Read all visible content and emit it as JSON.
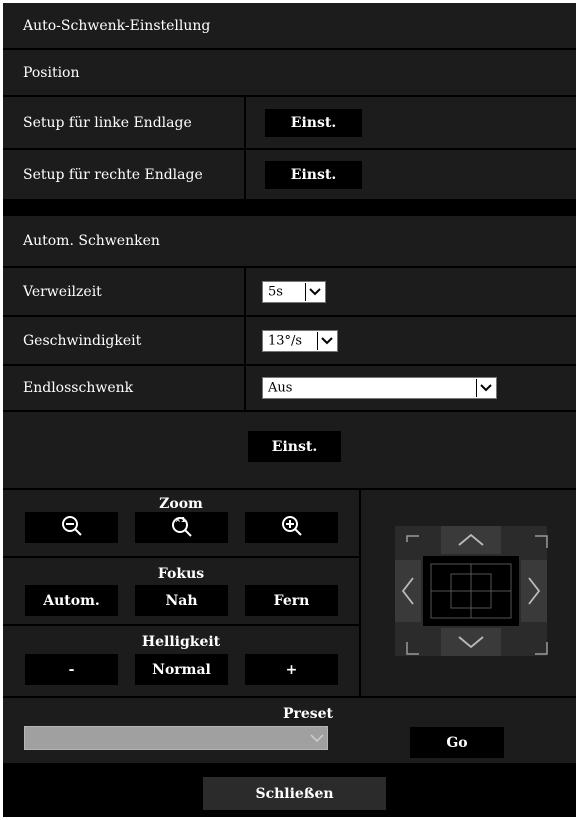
{
  "title": "Auto-Schwenk-Einstellung",
  "position": {
    "header": "Position",
    "left_end_label": "Setup für linke Endlage",
    "right_end_label": "Setup für rechte Endlage",
    "set_label": "Einst."
  },
  "auto_pan": {
    "header": "Autom. Schwenken",
    "dwell_label": "Verweilzeit",
    "dwell_value": "5s",
    "speed_label": "Geschwindigkeit",
    "speed_value": "13°/s",
    "endless_label": "Endlosschwenk",
    "endless_value": "Aus",
    "set_label": "Einst."
  },
  "control": {
    "zoom_title": "Zoom",
    "focus_title": "Fokus",
    "focus_auto": "Autom.",
    "focus_near": "Nah",
    "focus_far": "Fern",
    "brightness_title": "Helligkeit",
    "brightness_minus": "-",
    "brightness_normal": "Normal",
    "brightness_plus": "+",
    "zoom_x1_label": "×1"
  },
  "preset": {
    "title": "Preset",
    "value": "",
    "go_label": "Go"
  },
  "close_label": "Schließen",
  "icons": [
    "zoom-out-icon",
    "zoom-reset-icon",
    "zoom-in-icon",
    "chevron-down-icon",
    "arrow-up-icon",
    "arrow-down-icon",
    "arrow-left-icon",
    "arrow-right-icon"
  ],
  "colors": {
    "background": "#000000",
    "row": "#1c1c1c",
    "button": "#000000",
    "close_button": "#2b2b2b"
  }
}
